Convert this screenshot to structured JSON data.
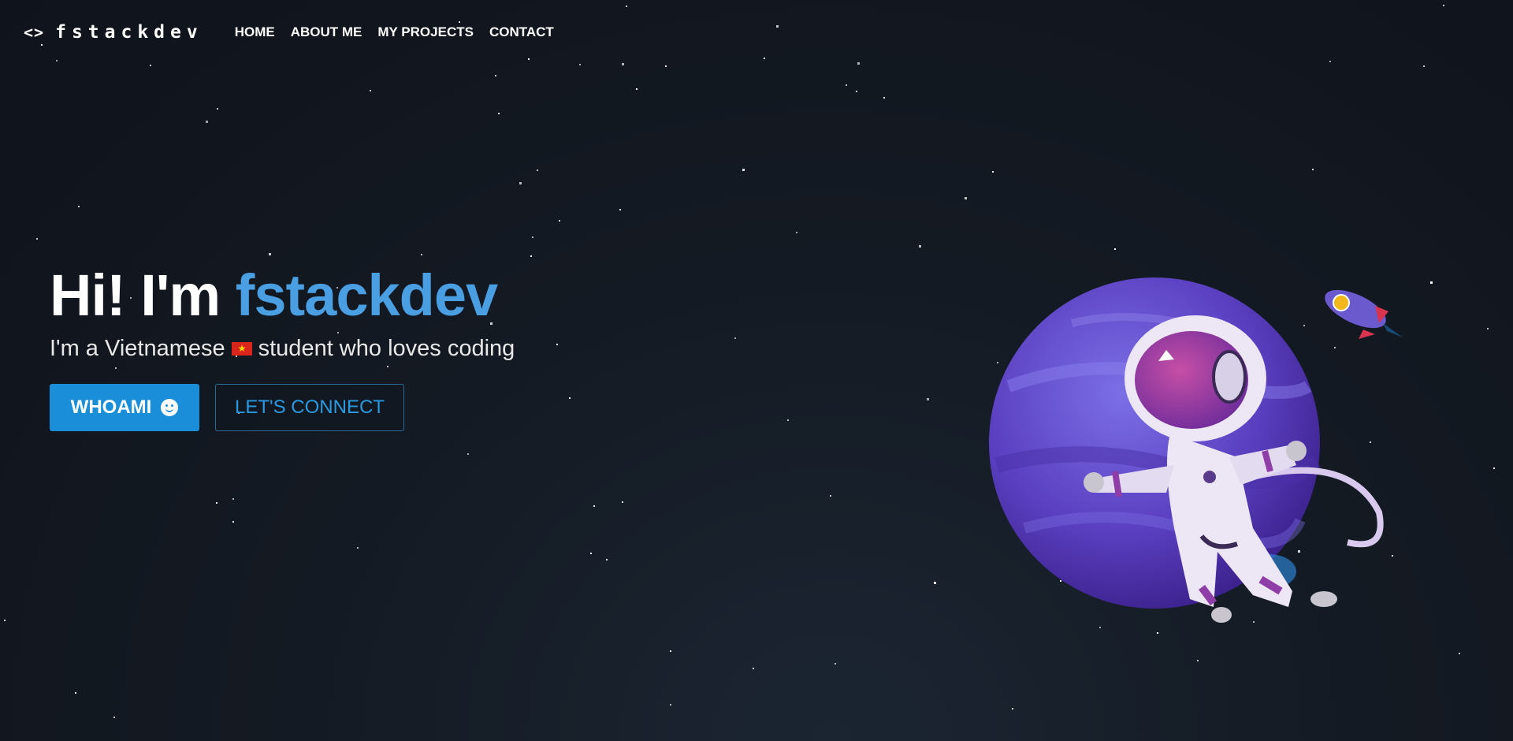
{
  "nav": {
    "logo_icon": "<>",
    "logo_text": "fstackdev",
    "links": [
      "HOME",
      "ABOUT ME",
      "MY PROJECTS",
      "CONTACT"
    ]
  },
  "hero": {
    "greeting": "Hi! I'm",
    "name": "fstackdev",
    "subtitle_before": "I'm a Vietnamese",
    "subtitle_after": "student who loves coding",
    "primary_button": "WHOAMI",
    "secondary_button": "LET'S CONNECT"
  },
  "colors": {
    "accent": "#4a9ee2",
    "button_primary": "#1a8ed8",
    "background": "#12171f"
  },
  "icons": [
    "code-icon",
    "vietnam-flag-icon",
    "smile-icon",
    "astronaut-illustration",
    "planet-illustration",
    "rocket-illustration"
  ]
}
